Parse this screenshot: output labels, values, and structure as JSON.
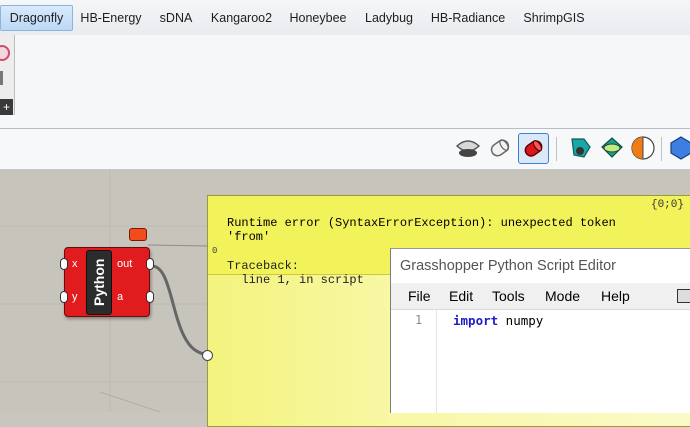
{
  "tabs": [
    {
      "label": "Dragonfly",
      "active": true
    },
    {
      "label": "HB-Energy"
    },
    {
      "label": "sDNA"
    },
    {
      "label": "Kangaroo2"
    },
    {
      "label": "Honeybee"
    },
    {
      "label": "Ladybug"
    },
    {
      "label": "HB-Radiance"
    },
    {
      "label": "ShrimpGIS"
    }
  ],
  "palette": {
    "expand_glyph": "+"
  },
  "toolbar": {
    "icons": [
      "preview-wireframe-icon",
      "preview-shaded-icon",
      "preview-selected-icon",
      "display-teal-icon",
      "display-green-icon",
      "display-orange-icon",
      "display-blue-icon"
    ]
  },
  "component": {
    "name": "Python",
    "inputs": [
      "x",
      "y"
    ],
    "outputs": [
      "out",
      "a"
    ],
    "color": "#e01c1f"
  },
  "error": {
    "coords": "{0;0}",
    "message": "Runtime error (SyntaxErrorException): unexpected token\n'from'",
    "traceback": "Traceback:\n  line 1, in script",
    "zero": "0"
  },
  "editor": {
    "title": "Grasshopper Python Script Editor",
    "menu": [
      "File",
      "Edit",
      "Tools",
      "Mode",
      "Help"
    ],
    "line_number": "1",
    "keyword": "import",
    "rest": " numpy"
  }
}
